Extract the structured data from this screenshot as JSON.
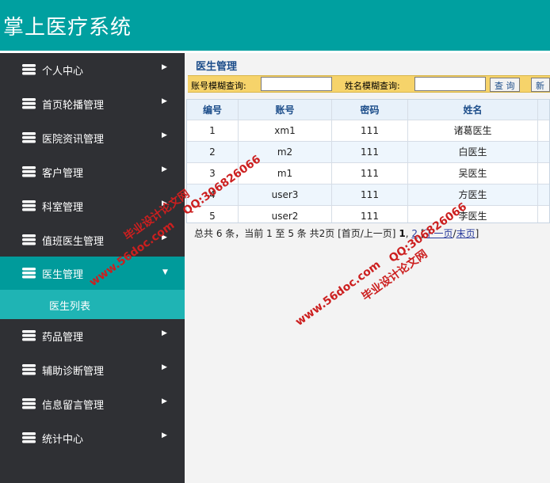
{
  "header": {
    "title": "掌上医疗系统"
  },
  "sidebar": {
    "items": [
      {
        "label": "个人中心",
        "arrow": "▶"
      },
      {
        "label": "首页轮播管理",
        "arrow": "▶"
      },
      {
        "label": "医院资讯管理",
        "arrow": "▶"
      },
      {
        "label": "客户管理",
        "arrow": "▶"
      },
      {
        "label": "科室管理",
        "arrow": "▶"
      },
      {
        "label": "值班医生管理",
        "arrow": "▶"
      },
      {
        "label": "医生管理",
        "arrow": "▼",
        "active": true
      },
      {
        "label": "药品管理",
        "arrow": "▶"
      },
      {
        "label": "辅助诊断管理",
        "arrow": "▶"
      },
      {
        "label": "信息留言管理",
        "arrow": "▶"
      },
      {
        "label": "统计中心",
        "arrow": "▶"
      }
    ],
    "sub_item": {
      "label": "医生列表"
    }
  },
  "main": {
    "page_title": "医生管理",
    "search": {
      "account_label": "账号模糊查询:",
      "account_value": "",
      "name_label": "姓名模糊查询:",
      "name_value": "",
      "query_button": "查 询",
      "add_button": "新 增"
    },
    "table": {
      "headers": [
        "编号",
        "账号",
        "密码",
        "姓名",
        ""
      ],
      "rows": [
        [
          "1",
          "xm1",
          "111",
          "诸葛医生",
          ""
        ],
        [
          "2",
          "m2",
          "111",
          "白医生",
          ""
        ],
        [
          "3",
          "m1",
          "111",
          "吴医生",
          ""
        ],
        [
          "4",
          "user3",
          "111",
          "方医生",
          ""
        ],
        [
          "5",
          "user2",
          "111",
          "李医生",
          ""
        ]
      ]
    },
    "pager": {
      "summary": "总共 6 条，当前 1 至 5 条 共2页",
      "first_prev": "[首页/上一页]",
      "current_page": "1",
      "sep": ",",
      "page2": "2",
      "next": "下一页",
      "slash": "/",
      "last": "末页",
      "close": "]",
      "open": "["
    }
  },
  "watermarks": {
    "site": "www.56doc.com",
    "qq": "QQ:306826066",
    "brand": "毕业设计论文网"
  },
  "colors": {
    "header": "#00a0a0",
    "sidebar": "#2f3034",
    "active_item": "#009b9b",
    "sub_item": "#1fb4b4",
    "search_bar": "#f6d36a",
    "watermark": "#cc1f1f"
  }
}
